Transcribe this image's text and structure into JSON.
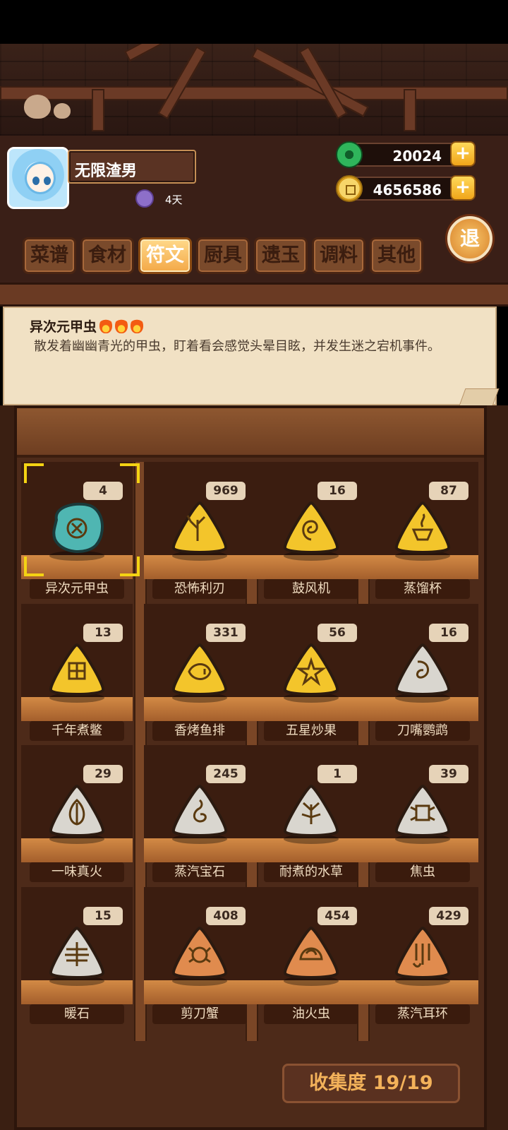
{
  "player": {
    "name": "无限渣男",
    "days": "4天"
  },
  "currency": {
    "jade": "20024",
    "gold": "4656586"
  },
  "exit_label": "退",
  "tabs": [
    {
      "label": "菜谱",
      "active": false
    },
    {
      "label": "食材",
      "active": false
    },
    {
      "label": "符文",
      "active": true
    },
    {
      "label": "厨具",
      "active": false
    },
    {
      "label": "遗玉",
      "active": false
    },
    {
      "label": "调料",
      "active": false
    },
    {
      "label": "其他",
      "active": false
    }
  ],
  "description": {
    "title": "异次元甲虫",
    "flames": 3,
    "text": "散发着幽幽青光的甲虫，盯着看会感觉头晕目眩，并发生迷之宕机事件。"
  },
  "items": [
    {
      "name": "异次元甲虫",
      "count": "4",
      "color": "#4fb6b2",
      "shape": "blob",
      "icon": "beetle-icon",
      "selected": true
    },
    {
      "name": "恐怖利刃",
      "count": "969",
      "color": "#f3c52b",
      "shape": "tri",
      "icon": "antler-icon"
    },
    {
      "name": "鼓风机",
      "count": "16",
      "color": "#f3c52b",
      "shape": "tri",
      "icon": "shell-icon"
    },
    {
      "name": "蒸馏杯",
      "count": "87",
      "color": "#f3c52b",
      "shape": "tri",
      "icon": "cup-icon"
    },
    {
      "name": "千年煮鳖",
      "count": "13",
      "color": "#f3c52b",
      "shape": "tri",
      "icon": "turtle-icon"
    },
    {
      "name": "香烤鱼排",
      "count": "331",
      "color": "#f3c52b",
      "shape": "tri",
      "icon": "fish-icon"
    },
    {
      "name": "五星炒果",
      "count": "56",
      "color": "#f3c52b",
      "shape": "tri",
      "icon": "star-icon"
    },
    {
      "name": "刀嘴鹦鹉",
      "count": "16",
      "color": "#d9d6cf",
      "shape": "tri",
      "icon": "parrot-icon"
    },
    {
      "name": "一味真火",
      "count": "29",
      "color": "#d9d6cf",
      "shape": "tri",
      "icon": "leaf-icon"
    },
    {
      "name": "蒸汽宝石",
      "count": "245",
      "color": "#d9d6cf",
      "shape": "tri",
      "icon": "spiral-icon"
    },
    {
      "name": "耐煮的水草",
      "count": "1",
      "color": "#d9d6cf",
      "shape": "tri",
      "icon": "waterweed-icon"
    },
    {
      "name": "焦虫",
      "count": "39",
      "color": "#d9d6cf",
      "shape": "tri",
      "icon": "bug-icon"
    },
    {
      "name": "暖石",
      "count": "15",
      "color": "#d9d6cf",
      "shape": "tri",
      "icon": "waves-icon"
    },
    {
      "name": "剪刀蟹",
      "count": "408",
      "color": "#e08b4e",
      "shape": "tri",
      "icon": "crab-icon"
    },
    {
      "name": "油火虫",
      "count": "454",
      "color": "#e08b4e",
      "shape": "tri",
      "icon": "shell-bug-icon"
    },
    {
      "name": "蒸汽耳环",
      "count": "429",
      "color": "#e08b4e",
      "shape": "tri",
      "icon": "earring-icon"
    }
  ],
  "collection": {
    "label": "收集度 19/19"
  }
}
